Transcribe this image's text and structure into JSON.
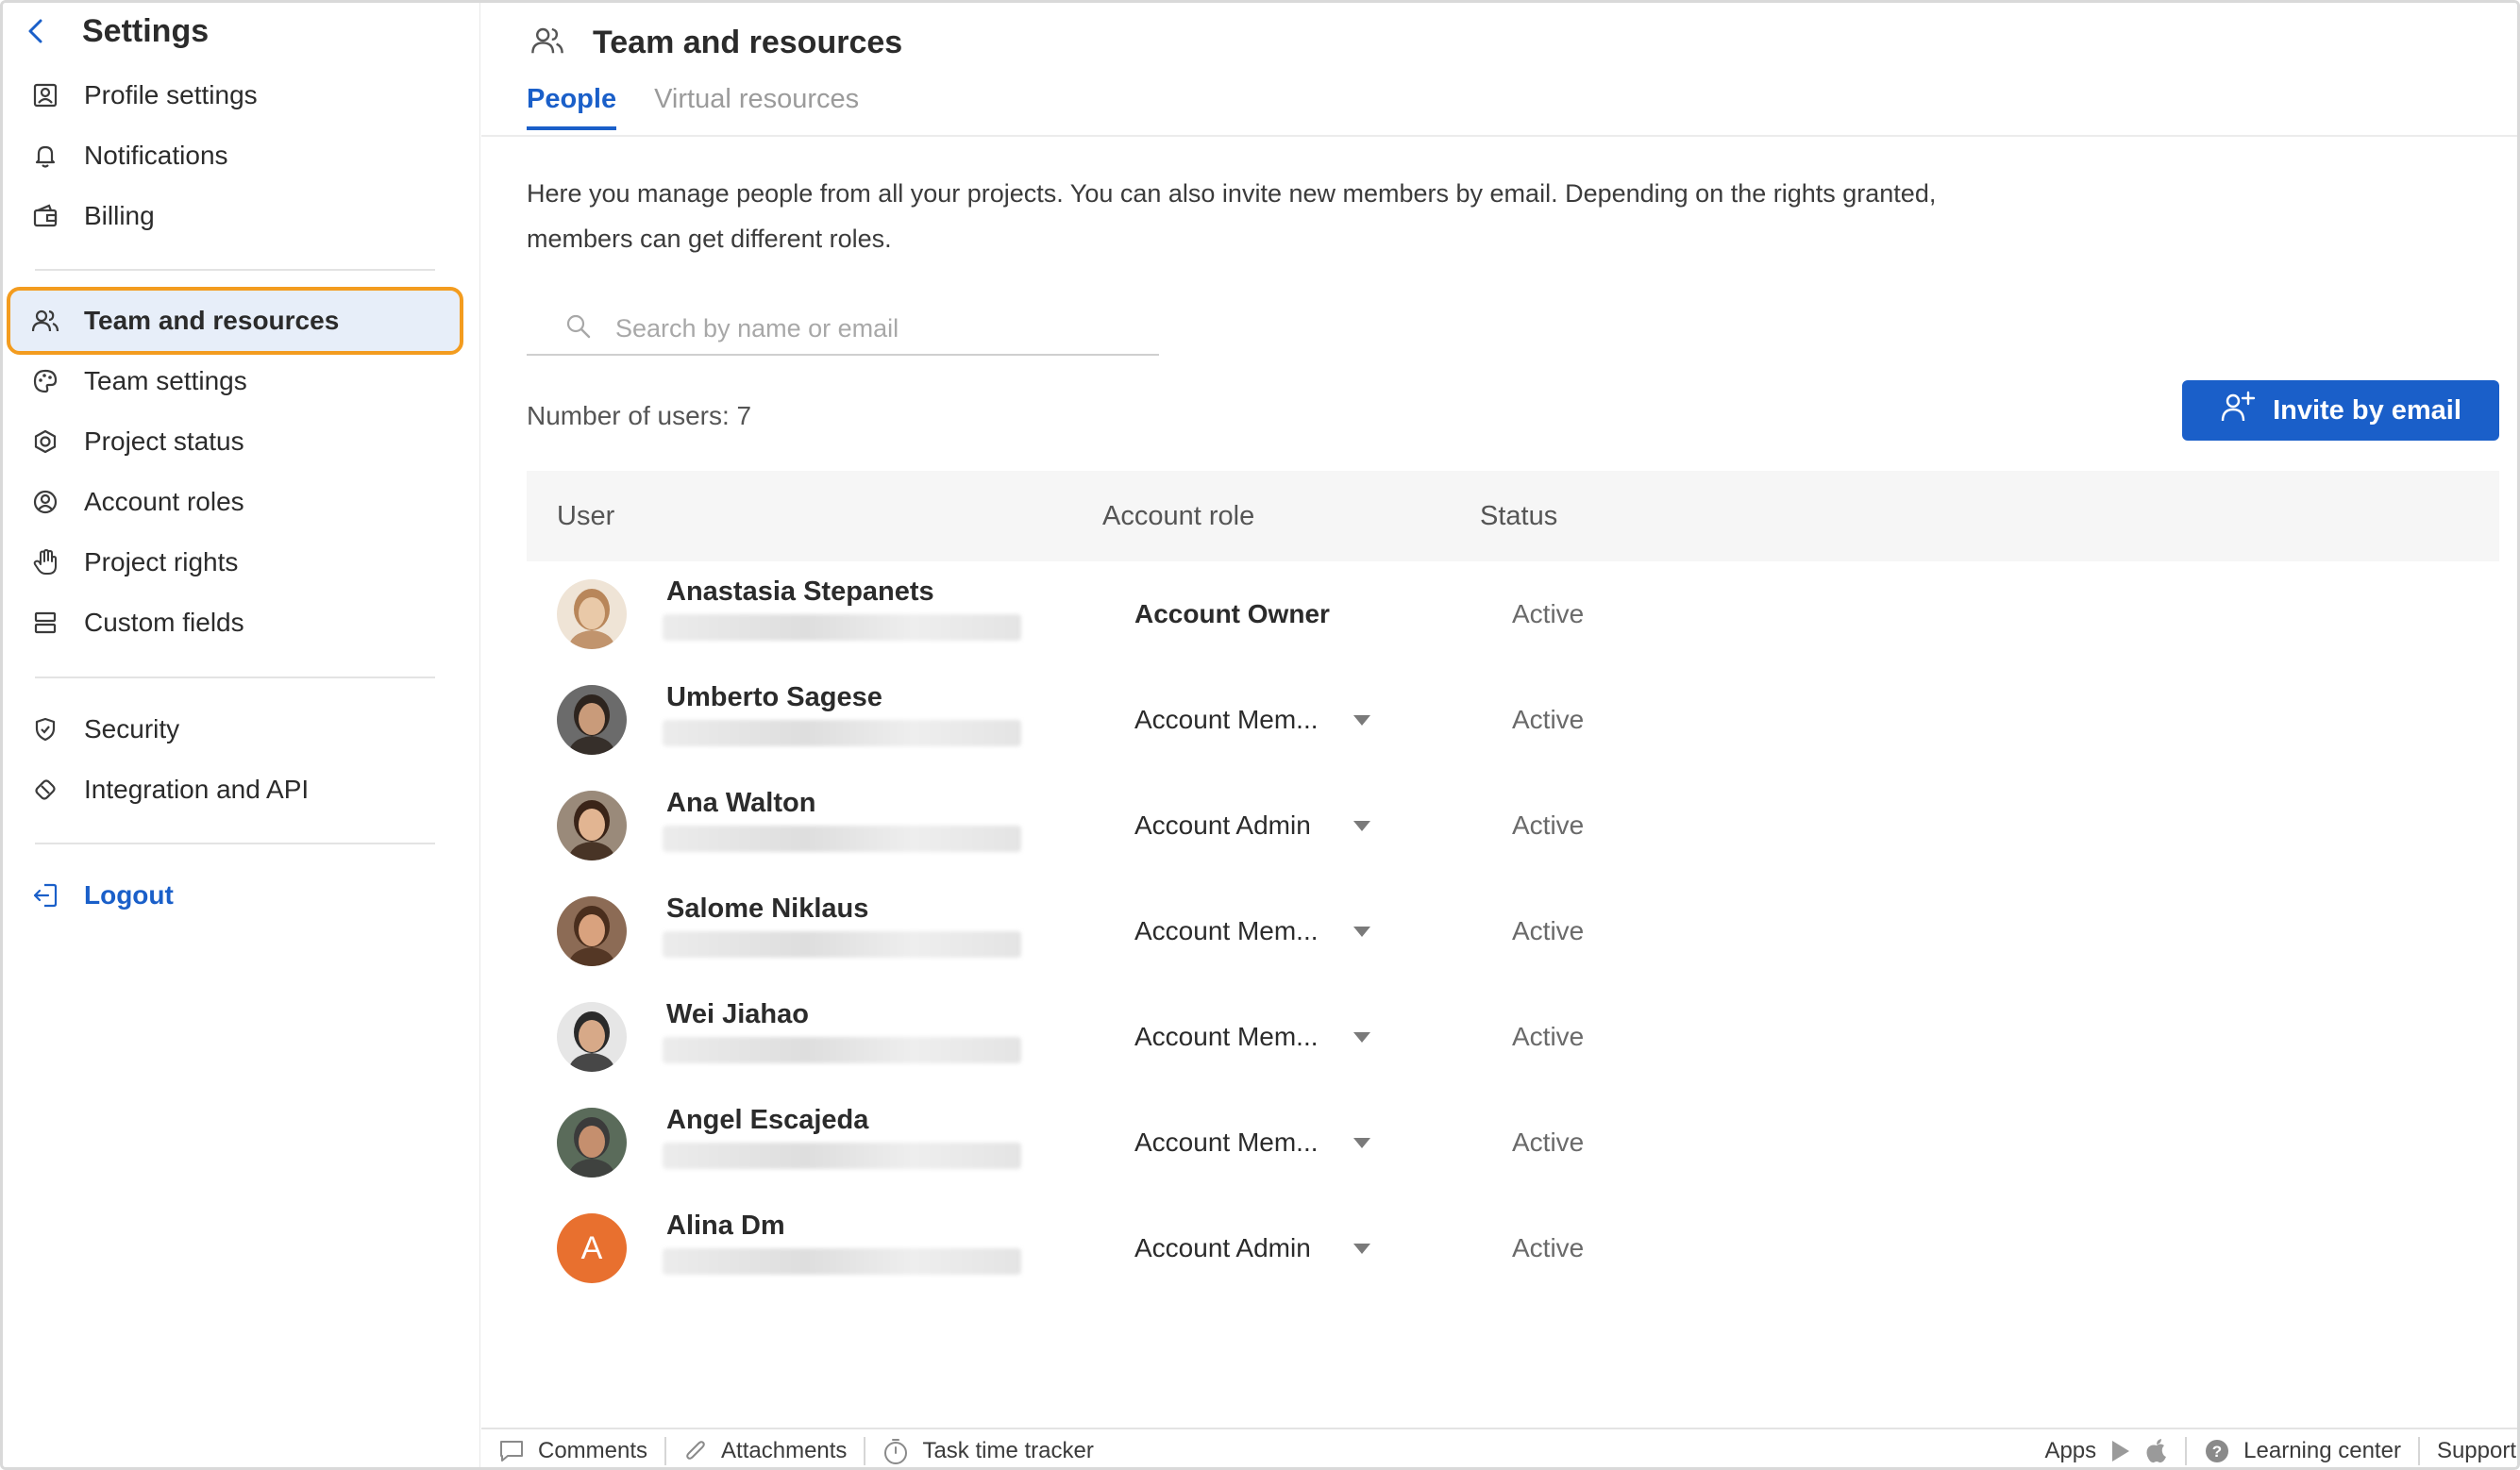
{
  "sidebar": {
    "title": "Settings",
    "group1": [
      {
        "label": "Profile settings",
        "icon": "user-card-icon"
      },
      {
        "label": "Notifications",
        "icon": "bell-icon"
      },
      {
        "label": "Billing",
        "icon": "wallet-icon"
      }
    ],
    "group2": [
      {
        "label": "Team and resources",
        "icon": "team-icon",
        "active": true
      },
      {
        "label": "Team settings",
        "icon": "palette-icon"
      },
      {
        "label": "Project status",
        "icon": "hexagon-icon"
      },
      {
        "label": "Account roles",
        "icon": "user-circle-icon"
      },
      {
        "label": "Project rights",
        "icon": "hand-icon"
      },
      {
        "label": "Custom fields",
        "icon": "fields-icon"
      }
    ],
    "group3": [
      {
        "label": "Security",
        "icon": "shield-icon"
      },
      {
        "label": "Integration and API",
        "icon": "integration-icon"
      }
    ],
    "logout": "Logout"
  },
  "header": {
    "title": "Team and resources",
    "tabs": [
      {
        "label": "People",
        "active": true
      },
      {
        "label": "Virtual resources",
        "active": false
      }
    ]
  },
  "main": {
    "description": "Here you manage people from all your projects. You can also invite new members by email. Depending on the rights granted, members can get different roles.",
    "search_placeholder": "Search by name or email",
    "user_count": "Number of users: 7",
    "invite_label": "Invite by email",
    "columns": {
      "user": "User",
      "role": "Account role",
      "status": "Status"
    },
    "users": [
      {
        "name": "Anastasia Stepanets",
        "role": "Account Owner",
        "status": "Active",
        "avatar": "photo",
        "editable": false
      },
      {
        "name": "Umberto Sagese",
        "role": "Account Mem...",
        "status": "Active",
        "avatar": "photo",
        "editable": true
      },
      {
        "name": "Ana Walton",
        "role": "Account Admin",
        "status": "Active",
        "avatar": "photo",
        "editable": true
      },
      {
        "name": "Salome Niklaus",
        "role": "Account Mem...",
        "status": "Active",
        "avatar": "photo",
        "editable": true
      },
      {
        "name": "Wei Jiahao",
        "role": "Account Mem...",
        "status": "Active",
        "avatar": "photo",
        "editable": true
      },
      {
        "name": "Angel Escajeda",
        "role": "Account Mem...",
        "status": "Active",
        "avatar": "photo",
        "editable": true
      },
      {
        "name": "Alina Dm",
        "role": "Account Admin",
        "status": "Active",
        "avatar": "letter",
        "letter": "A",
        "editable": true
      }
    ]
  },
  "footer": {
    "comments": "Comments",
    "attachments": "Attachments",
    "time_tracker": "Task time tracker",
    "apps": "Apps",
    "learning_center": "Learning center",
    "support": "Support"
  },
  "colors": {
    "accent": "#1a5fc9",
    "active_outline": "#f39c1f",
    "active_bg": "#e7eef9",
    "letter_avatar": "#e8702f"
  }
}
